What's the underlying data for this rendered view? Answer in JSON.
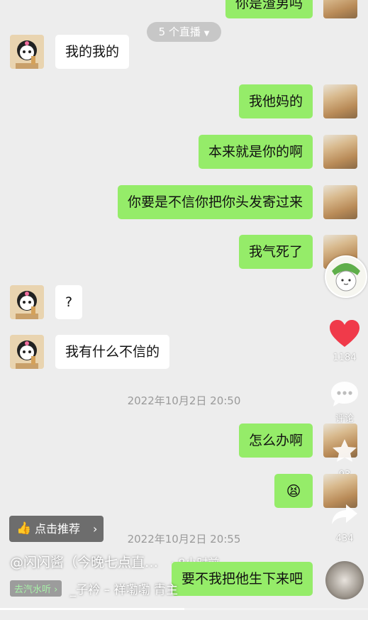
{
  "top_partial_message": "你是渣男吗",
  "live_pill": "5 个直播",
  "messages": [
    {
      "side": "left",
      "text": "我的我的"
    },
    {
      "side": "right",
      "text": "我他妈的"
    },
    {
      "side": "right",
      "text": "本来就是你的啊"
    },
    {
      "side": "right",
      "text": "你要是不信你把你头发寄过来"
    },
    {
      "side": "right",
      "text": "我气死了"
    },
    {
      "side": "left",
      "text": "?"
    },
    {
      "side": "left",
      "text": "我有什么不信的"
    },
    {
      "side": "right",
      "text": "怎么办啊"
    },
    {
      "side": "right",
      "text": "😫"
    },
    {
      "side": "right",
      "text": "要不我把他生下来吧"
    }
  ],
  "timestamps": [
    "2022年10月2日 20:50",
    "2022年10月2日 20:55"
  ],
  "sidebar": {
    "like_count": "1184",
    "comment_label": "评论",
    "favorite_count": "93",
    "share_count": "434"
  },
  "recommend_button": "点击推荐",
  "caption": "@闪闪酱（今晚七点直…",
  "time_ago": "· 8小时前",
  "music_tag": "去汽水听",
  "music_title": "_子衿 – 祥嘞嘞   青主",
  "colors": {
    "background": "#ededed",
    "sent_bubble": "#95ec69",
    "received_bubble": "#ffffff",
    "like_heart": "#f03a4a"
  }
}
